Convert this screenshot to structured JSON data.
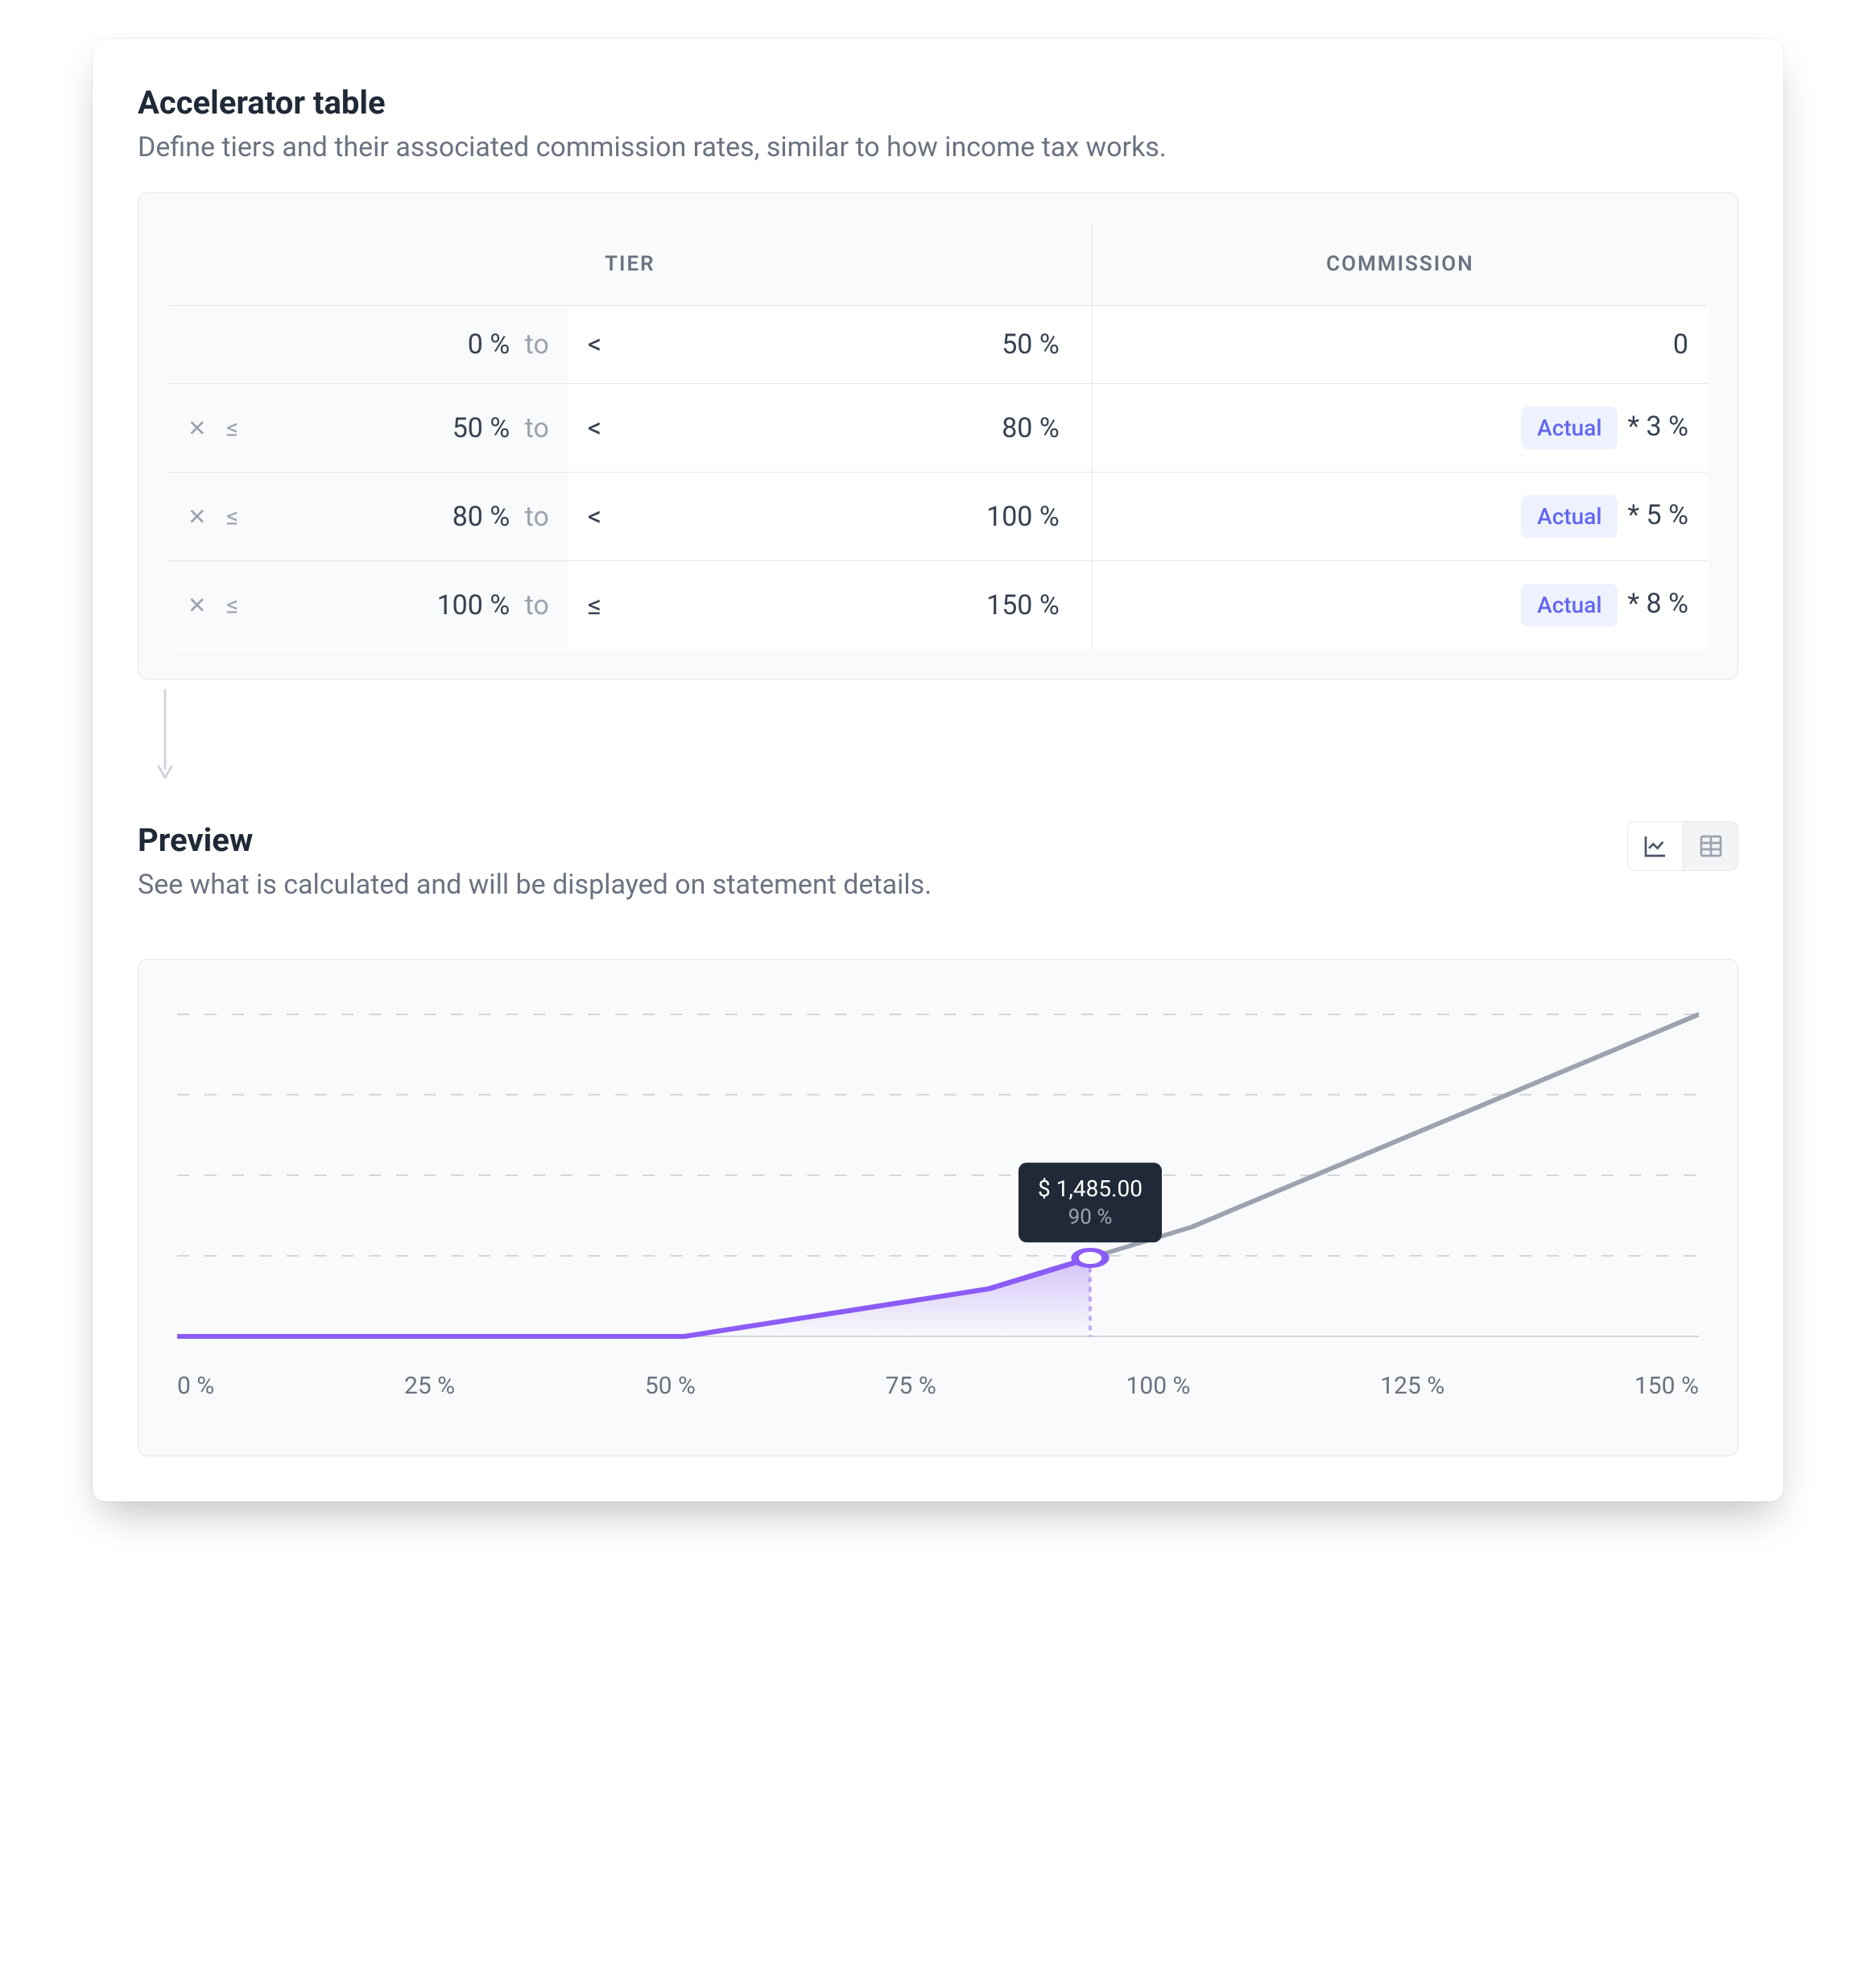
{
  "accelerator": {
    "title": "Accelerator table",
    "description": "Define tiers and their associated commission rates, similar to how income tax works.",
    "headers": {
      "tier": "TIER",
      "commission": "COMMISSION"
    },
    "to_word": "to",
    "badge_label": "Actual",
    "rows": [
      {
        "removable": false,
        "from": "0 %",
        "op": "<",
        "to": "50 %",
        "commission_text": "0",
        "has_formula": false
      },
      {
        "removable": true,
        "from": "50 %",
        "op": "<",
        "to": "80 %",
        "commission_text": "* 3 %",
        "has_formula": true
      },
      {
        "removable": true,
        "from": "80 %",
        "op": "<",
        "to": "100 %",
        "commission_text": "* 5 %",
        "has_formula": true
      },
      {
        "removable": true,
        "from": "100 %",
        "op": "≤",
        "to": "150 %",
        "commission_text": "* 8 %",
        "has_formula": true
      }
    ]
  },
  "preview": {
    "title": "Preview",
    "description": "See what is calculated and will be displayed on statement details.",
    "view_mode": "chart",
    "tooltip": {
      "amount": "$ 1,485.00",
      "percent": "90 %"
    }
  },
  "chart_data": {
    "type": "line",
    "xlabel": "",
    "ylabel": "",
    "x_ticks": [
      "0 %",
      "25 %",
      "50 %",
      "75 %",
      "100 %",
      "125 %",
      "150 %"
    ],
    "xlim": [
      0,
      150
    ],
    "series": [
      {
        "name": "commission",
        "x": [
          0,
          50,
          80,
          90,
          100,
          150
        ],
        "y": [
          0,
          0,
          900,
          1485,
          2070,
          6095
        ],
        "highlight_end": 90
      }
    ],
    "gridlines_y": [
      0,
      1525,
      3050,
      4575,
      6095
    ],
    "marker": {
      "x": 90,
      "y": 1485
    }
  },
  "colors": {
    "accent": "#8b5cf6",
    "muted_line": "#9ca3af",
    "grid": "#d1d5db",
    "tooltip_bg": "#1f2937"
  }
}
